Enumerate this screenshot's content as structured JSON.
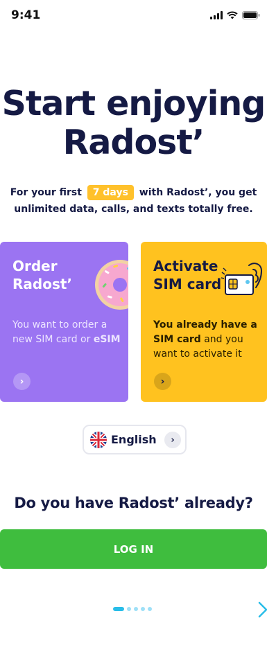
{
  "status_bar": {
    "time": "9:41"
  },
  "hero": {
    "title_line1": "Start enjoying",
    "title_line2": "Radost’"
  },
  "intro": {
    "before_badge": "For your first",
    "badge": "7 days",
    "after_badge": "with Radost’, you get unlimited data, calls, and texts totally free."
  },
  "cards": {
    "order": {
      "title_line1": "Order",
      "title_line2": "Radost’",
      "desc_part1": "You want to order a new SIM card or ",
      "desc_bold": "eSIM",
      "arrow": "›"
    },
    "activate": {
      "title_line1": "Activate",
      "title_line2": "SIM card",
      "desc_bold1": "You already have a SIM card",
      "desc_part2": " and you want to activate it",
      "arrow": "›"
    }
  },
  "language": {
    "label": "English",
    "flag_icon": "uk-flag-icon",
    "arrow": "›"
  },
  "login": {
    "question": "Do you have Radost’ already?",
    "button_label": "LOG IN"
  },
  "pager": {
    "pages": 5,
    "active_index": 0
  },
  "colors": {
    "navy": "#151a44",
    "purple_card": "#9b74f2",
    "yellow_card": "#ffc21f",
    "badge_yellow": "#ffc12b",
    "green_button": "#3fbd3e",
    "pager_blue": "#29bde8"
  }
}
